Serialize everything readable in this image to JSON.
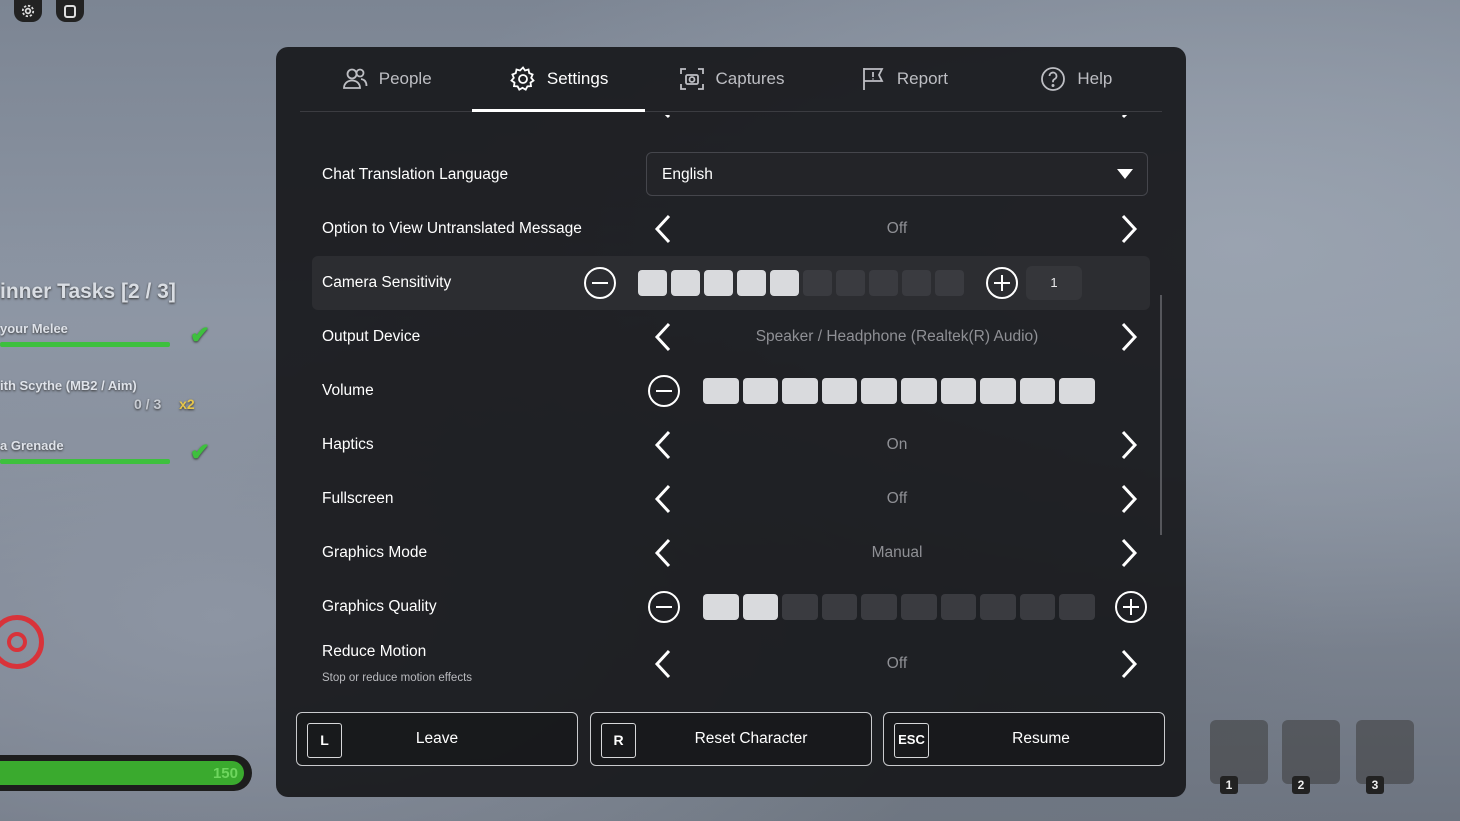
{
  "background": {
    "tasks_title": "inner Tasks   [2 / 3]",
    "tasks": [
      {
        "label": "your Melee",
        "progress": "",
        "multiplier": "",
        "done": true
      },
      {
        "label": "ith Scythe (MB2 / Aim)",
        "progress": "0 / 3",
        "multiplier": "x2",
        "done": false
      },
      {
        "label": "a Grenade",
        "progress": "",
        "multiplier": "",
        "done": true
      }
    ],
    "health_value": "150",
    "hotbar": [
      "1",
      "2",
      "3"
    ]
  },
  "tabs": [
    {
      "label": "People",
      "icon": "people-icon",
      "active": false
    },
    {
      "label": "Settings",
      "icon": "gear-icon",
      "active": true
    },
    {
      "label": "Captures",
      "icon": "camera-icon",
      "active": false
    },
    {
      "label": "Report",
      "icon": "flag-icon",
      "active": false
    },
    {
      "label": "Help",
      "icon": "help-icon",
      "active": false
    }
  ],
  "settings": {
    "chat_translation_language": {
      "label": "Chat Translation Language",
      "value": "English"
    },
    "untranslated_message": {
      "label": "Option to View Untranslated Message",
      "value": "Off"
    },
    "camera_sensitivity": {
      "label": "Camera Sensitivity",
      "level": 5,
      "segments": 10,
      "value": "1"
    },
    "output_device": {
      "label": "Output Device",
      "value": "Speaker / Headphone (Realtek(R) Audio)"
    },
    "volume": {
      "label": "Volume",
      "level": 10,
      "segments": 10
    },
    "haptics": {
      "label": "Haptics",
      "value": "On"
    },
    "fullscreen": {
      "label": "Fullscreen",
      "value": "Off"
    },
    "graphics_mode": {
      "label": "Graphics Mode",
      "value": "Manual"
    },
    "graphics_quality": {
      "label": "Graphics Quality",
      "level": 2,
      "segments": 10
    },
    "reduce_motion": {
      "label": "Reduce Motion",
      "sublabel": "Stop or reduce motion effects",
      "value": "Off"
    }
  },
  "actions": {
    "leave": {
      "key": "L",
      "label": "Leave"
    },
    "reset": {
      "key": "R",
      "label": "Reset Character"
    },
    "resume": {
      "key": "ESC",
      "label": "Resume"
    }
  },
  "colors": {
    "accent": "#ffffff",
    "segment_on": "#d9dadd",
    "segment_off": "#3a3b40",
    "task_green": "#3ec03e"
  }
}
